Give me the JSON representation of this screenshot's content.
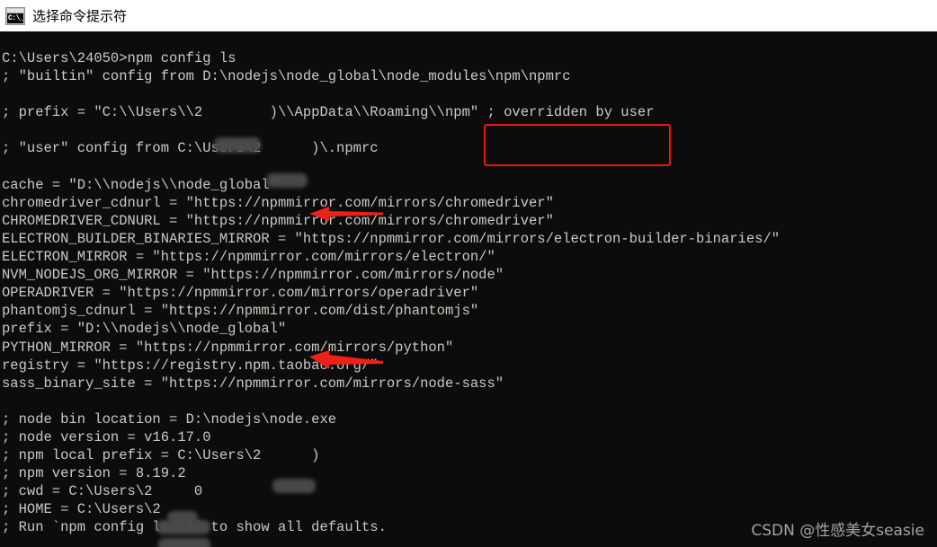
{
  "window": {
    "title": "选择命令提示符",
    "icon": "cmd-console-icon",
    "icon_glyph": "C:\\_"
  },
  "theme": {
    "titlebar_bg": "#ffffff",
    "terminal_bg": "#0c0c0c",
    "terminal_fg": "#ccc9c2",
    "annotation_red": "#e8190f",
    "watermark_color": "#b9b9b9"
  },
  "terminal": {
    "lines": [
      "C:\\Users\\24050>npm config ls",
      "; \"builtin\" config from D:\\nodejs\\node_global\\node_modules\\npm\\npmrc",
      "",
      "; prefix = \"C:\\\\Users\\\\2        )\\\\AppData\\\\Roaming\\\\npm\" ; overridden by user",
      "",
      "; \"user\" config from C:\\Users\\2      )\\.npmrc",
      "",
      "cache = \"D:\\\\nodejs\\\\node_global\"",
      "chromedriver_cdnurl = \"https://npmmirror.com/mirrors/chromedriver\"",
      "CHROMEDRIVER_CDNURL = \"https://npmmirror.com/mirrors/chromedriver\"",
      "ELECTRON_BUILDER_BINARIES_MIRROR = \"https://npmmirror.com/mirrors/electron-builder-binaries/\"",
      "ELECTRON_MIRROR = \"https://npmmirror.com/mirrors/electron/\"",
      "NVM_NODEJS_ORG_MIRROR = \"https://npmmirror.com/mirrors/node\"",
      "OPERADRIVER = \"https://npmmirror.com/mirrors/operadriver\"",
      "phantomjs_cdnurl = \"https://npmmirror.com/dist/phantomjs\"",
      "prefix = \"D:\\\\nodejs\\\\node_global\"",
      "PYTHON_MIRROR = \"https://npmmirror.com/mirrors/python\"",
      "registry = \"https://registry.npm.taobao.org/\"",
      "sass_binary_site = \"https://npmmirror.com/mirrors/node-sass\"",
      "",
      "; node bin location = D:\\nodejs\\node.exe",
      "; node version = v16.17.0",
      "; npm local prefix = C:\\Users\\2      )",
      "; npm version = 8.19.2",
      "; cwd = C:\\Users\\2     0",
      "; HOME = C:\\Users\\2      ",
      "; Run `npm config ls -l` to show all defaults."
    ],
    "prompt_path": "C:\\Users\\24050",
    "command": "npm config ls",
    "node_version": "v16.17.0",
    "npm_version": "8.19.2",
    "node_bin_location": "D:\\nodejs\\node.exe",
    "cache_value": "D:\\\\nodejs\\\\node_global",
    "prefix_value": "D:\\\\nodejs\\\\node_global",
    "registry_value": "https://registry.npm.taobao.org/"
  },
  "annotations": {
    "box_label": "overridden by user",
    "arrow_cache_target": "cache = \"D:\\\\nodejs\\\\node_global\"",
    "arrow_prefix_target": "prefix = \"D:\\\\nodejs\\\\node_global\""
  },
  "watermark": {
    "text": "CSDN @性感美女seasie"
  }
}
